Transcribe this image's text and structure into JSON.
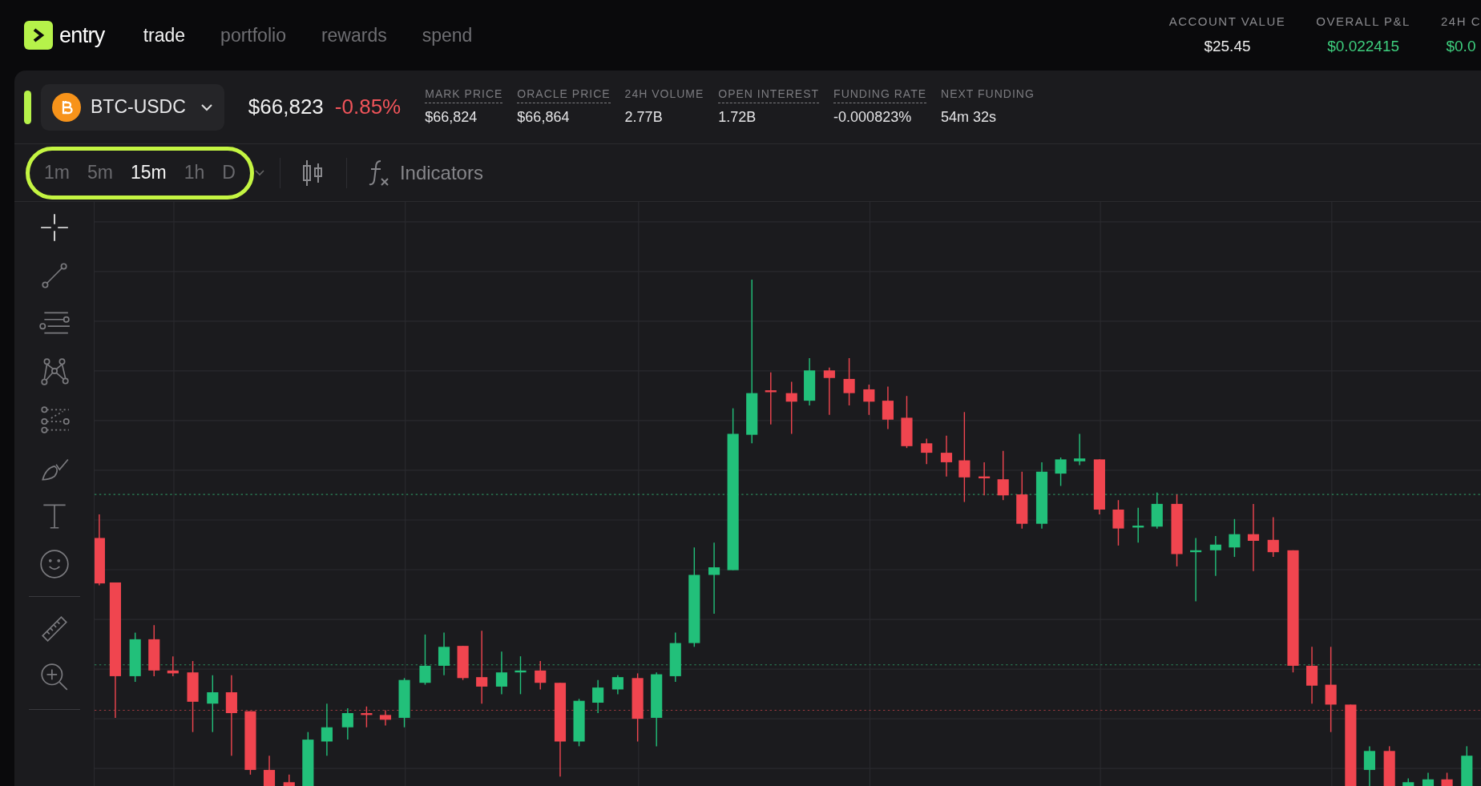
{
  "brand": {
    "name": "entry"
  },
  "nav": [
    {
      "label": "trade",
      "selected": true
    },
    {
      "label": "portfolio",
      "selected": false
    },
    {
      "label": "rewards",
      "selected": false
    },
    {
      "label": "spend",
      "selected": false
    }
  ],
  "account": [
    {
      "label": "ACCOUNT VALUE",
      "value": "$25.45",
      "kind": "neutral"
    },
    {
      "label": "OVERALL P&L",
      "value": "$0.022415",
      "kind": "positive"
    },
    {
      "label": "24H C",
      "value": "$0.0",
      "kind": "positive"
    }
  ],
  "market": {
    "symbol": "BTC-USDC",
    "price": "$66,823",
    "change": "-0.85%",
    "negative": true
  },
  "stats": [
    {
      "label": "MARK PRICE",
      "value": "$66,824",
      "underlined": true
    },
    {
      "label": "ORACLE PRICE",
      "value": "$66,864",
      "underlined": true
    },
    {
      "label": "24H VOLUME",
      "value": "2.77B",
      "underlined": false
    },
    {
      "label": "OPEN INTEREST",
      "value": "1.72B",
      "underlined": true
    },
    {
      "label": "FUNDING RATE",
      "value": "-0.000823%",
      "underlined": true
    },
    {
      "label": "NEXT FUNDING",
      "value": "54m 32s",
      "underlined": false
    }
  ],
  "timeframes": {
    "highlighted": true,
    "items": [
      {
        "label": "1m",
        "selected": false
      },
      {
        "label": "5m",
        "selected": false
      },
      {
        "label": "15m",
        "selected": true
      },
      {
        "label": "1h",
        "selected": false
      },
      {
        "label": "D",
        "selected": false
      }
    ]
  },
  "indicators_button": {
    "label": "Indicators"
  },
  "tools": [
    {
      "kind": "crosshair",
      "selected": true
    },
    {
      "kind": "trendline",
      "selected": false
    },
    {
      "kind": "fib",
      "selected": false
    },
    {
      "kind": "pattern",
      "selected": false
    },
    {
      "kind": "projection",
      "selected": false
    },
    {
      "kind": "brush",
      "selected": false
    },
    {
      "kind": "text",
      "selected": false
    },
    {
      "kind": "emoji",
      "selected": false
    },
    {
      "kind": "divider"
    },
    {
      "kind": "ruler",
      "selected": false
    },
    {
      "kind": "zoom",
      "selected": false
    },
    {
      "kind": "divider"
    }
  ]
}
